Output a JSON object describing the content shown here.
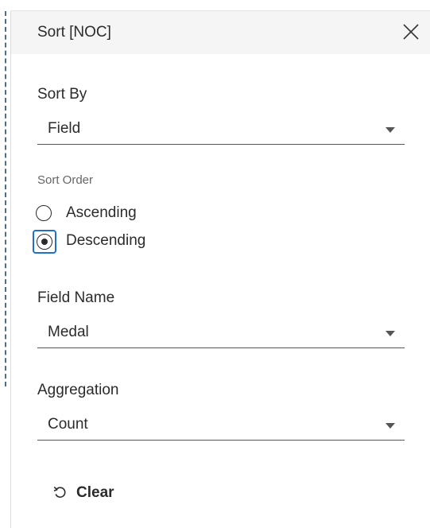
{
  "dialog": {
    "title": "Sort [NOC]",
    "close_icon": "close-icon"
  },
  "sort_by": {
    "label": "Sort By",
    "value": "Field"
  },
  "sort_order": {
    "label": "Sort Order",
    "options": [
      {
        "label": "Ascending",
        "checked": false
      },
      {
        "label": "Descending",
        "checked": true
      }
    ]
  },
  "field_name": {
    "label": "Field Name",
    "value": "Medal"
  },
  "aggregation": {
    "label": "Aggregation",
    "value": "Count"
  },
  "clear": {
    "label": "Clear",
    "icon": "undo-icon"
  },
  "colors": {
    "focus_ring": "#1f6fc5",
    "header_bg": "#f5f5f5",
    "selection_dash": "#4a6f8c"
  }
}
